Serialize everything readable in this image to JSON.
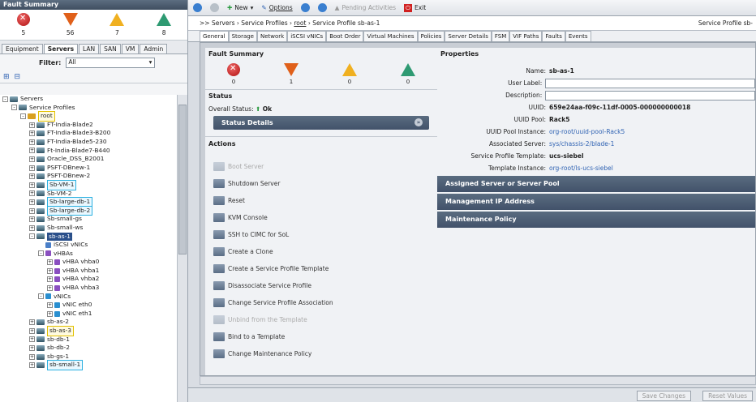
{
  "fault_summary": {
    "title": "Fault Summary",
    "counts": [
      "5",
      "56",
      "7",
      "8"
    ]
  },
  "nav_tabs": [
    "Equipment",
    "Servers",
    "LAN",
    "SAN",
    "VM",
    "Admin"
  ],
  "filter": {
    "label": "Filter:",
    "value": "All"
  },
  "tree": [
    {
      "label": "Servers",
      "indent": 0,
      "exp": "-",
      "icon": "server"
    },
    {
      "label": "Service Profiles",
      "indent": 1,
      "exp": "-",
      "icon": "server"
    },
    {
      "label": "root",
      "indent": 2,
      "exp": "-",
      "icon": "org",
      "style": "hl2"
    },
    {
      "label": "FT-India-Blade2",
      "indent": 3,
      "exp": "+",
      "icon": "server"
    },
    {
      "label": "FT-India-Blade3-B200",
      "indent": 3,
      "exp": "+",
      "icon": "server"
    },
    {
      "label": "FT-India-Blade5-230",
      "indent": 3,
      "exp": "+",
      "icon": "server"
    },
    {
      "label": "Ft-India-Blade7-B440",
      "indent": 3,
      "exp": "+",
      "icon": "server"
    },
    {
      "label": "Oracle_DSS_B2001",
      "indent": 3,
      "exp": "+",
      "icon": "server"
    },
    {
      "label": "PSFT-DBnew-1",
      "indent": 3,
      "exp": "+",
      "icon": "server"
    },
    {
      "label": "PSFT-DBnew-2",
      "indent": 3,
      "exp": "+",
      "icon": "server"
    },
    {
      "label": "Sb-VM-1",
      "indent": 3,
      "exp": "+",
      "icon": "server",
      "style": "hl"
    },
    {
      "label": "Sb-VM-2",
      "indent": 3,
      "exp": "+",
      "icon": "server"
    },
    {
      "label": "Sb-large-db-1",
      "indent": 3,
      "exp": "+",
      "icon": "server",
      "style": "hl"
    },
    {
      "label": "Sb-large-db-2",
      "indent": 3,
      "exp": "+",
      "icon": "server",
      "style": "hl"
    },
    {
      "label": "Sb-small-gs",
      "indent": 3,
      "exp": "+",
      "icon": "server"
    },
    {
      "label": "Sb-small-ws",
      "indent": 3,
      "exp": "+",
      "icon": "server"
    },
    {
      "label": "sb-as-1",
      "indent": 3,
      "exp": "-",
      "icon": "server",
      "style": "selnode"
    },
    {
      "label": "iSCSI vNICs",
      "indent": 4,
      "exp": "",
      "icon": "v"
    },
    {
      "label": "vHBAs",
      "indent": 4,
      "exp": "-",
      "icon": "hba"
    },
    {
      "label": "vHBA vhba0",
      "indent": 5,
      "exp": "+",
      "icon": "hba"
    },
    {
      "label": "vHBA vhba1",
      "indent": 5,
      "exp": "+",
      "icon": "hba"
    },
    {
      "label": "vHBA vhba2",
      "indent": 5,
      "exp": "+",
      "icon": "hba"
    },
    {
      "label": "vHBA vhba3",
      "indent": 5,
      "exp": "+",
      "icon": "hba"
    },
    {
      "label": "vNICs",
      "indent": 4,
      "exp": "-",
      "icon": "net"
    },
    {
      "label": "vNIC eth0",
      "indent": 5,
      "exp": "+",
      "icon": "net"
    },
    {
      "label": "vNIC eth1",
      "indent": 5,
      "exp": "+",
      "icon": "net"
    },
    {
      "label": "sb-as-2",
      "indent": 3,
      "exp": "+",
      "icon": "server"
    },
    {
      "label": "sb-as-3",
      "indent": 3,
      "exp": "+",
      "icon": "server",
      "style": "hl2"
    },
    {
      "label": "sb-db-1",
      "indent": 3,
      "exp": "+",
      "icon": "server"
    },
    {
      "label": "sb-db-2",
      "indent": 3,
      "exp": "+",
      "icon": "server"
    },
    {
      "label": "sb-gs-1",
      "indent": 3,
      "exp": "+",
      "icon": "server"
    },
    {
      "label": "sb-small-1",
      "indent": 3,
      "exp": "+",
      "icon": "server",
      "style": "hl"
    }
  ],
  "toolbar": {
    "new": "New",
    "options": "Options",
    "pending": "Pending Activities",
    "exit": "Exit"
  },
  "crumbs": {
    "lead": ">>",
    "servers": "Servers",
    "profiles": "Service Profiles",
    "root": "root",
    "profile": "Service Profile sb-as-1",
    "right": "Service Profile sb-"
  },
  "main_tabs": [
    "General",
    "Storage",
    "Network",
    "iSCSI vNICs",
    "Boot Order",
    "Virtual Machines",
    "Policies",
    "Server Details",
    "FSM",
    "VIF Paths",
    "Faults",
    "Events"
  ],
  "general": {
    "fault_title": "Fault Summary",
    "fault_counts": [
      "0",
      "1",
      "0",
      "0"
    ],
    "status_title": "Status",
    "overall_label": "Overall Status:",
    "overall_value": "Ok",
    "status_details": "Status Details",
    "actions_title": "Actions",
    "actions": [
      {
        "label": "Boot Server",
        "enabled": false
      },
      {
        "label": "Shutdown Server",
        "enabled": true
      },
      {
        "label": "Reset",
        "enabled": true
      },
      {
        "label": "KVM Console",
        "enabled": true
      },
      {
        "label": "SSH to CIMC for SoL",
        "enabled": true
      },
      {
        "label": "Create a Clone",
        "enabled": true
      },
      {
        "label": "Create a Service Profile Template",
        "enabled": true
      },
      {
        "label": "Disassociate Service Profile",
        "enabled": true
      },
      {
        "label": "Change Service Profile Association",
        "enabled": true
      },
      {
        "label": "Unbind from the Template",
        "enabled": false
      },
      {
        "label": "Bind to a Template",
        "enabled": true
      },
      {
        "label": "Change Maintenance Policy",
        "enabled": true
      }
    ],
    "properties_title": "Properties",
    "props": {
      "name_k": "Name:",
      "name_v": "sb-as-1",
      "user_label_k": "User Label:",
      "desc_k": "Description:",
      "uuid_k": "UUID:",
      "uuid_v": "659e24aa-f09c-11df-0005-000000000018",
      "uuid_pool_k": "UUID Pool:",
      "uuid_pool_v": "Rack5",
      "uuid_pool_inst_k": "UUID Pool Instance:",
      "uuid_pool_inst_v": "org-root/uuid-pool-Rack5",
      "assoc_k": "Associated Server:",
      "assoc_v": "sys/chassis-2/blade-1",
      "tmpl_k": "Service Profile Template:",
      "tmpl_v": "ucs-siebel",
      "tmpl_inst_k": "Template Instance:",
      "tmpl_inst_v": "org-root/ls-ucs-siebel"
    },
    "sections": [
      "Assigned Server or Server Pool",
      "Management IP Address",
      "Maintenance Policy"
    ]
  },
  "footer": {
    "save": "Save Changes",
    "reset": "Reset Values"
  }
}
